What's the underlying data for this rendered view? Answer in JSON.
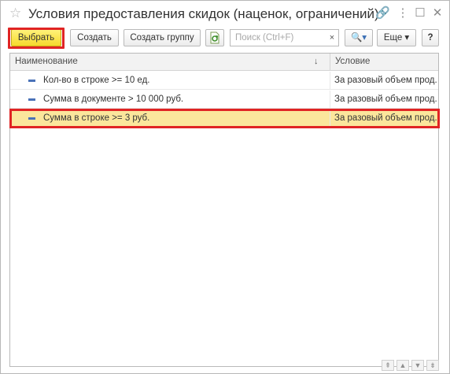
{
  "window": {
    "title": "Условия предоставления скидок (наценок, ограничений)"
  },
  "icons": {
    "star": "star-icon",
    "link": "link-icon",
    "more": "more-vertical-icon",
    "minimize": "minimize-icon",
    "maximize": "maximize-icon",
    "close": "close-icon"
  },
  "toolbar": {
    "select_label": "Выбрать",
    "create_label": "Создать",
    "create_group_label": "Создать группу",
    "search_placeholder": "Поиск (Ctrl+F)",
    "clear_label": "×",
    "search_label": "🔍▾",
    "more_label": "Еще ▾",
    "help_label": "?"
  },
  "table": {
    "columns": {
      "name": "Наименование",
      "condition": "Условие"
    },
    "sort_arrow": "↓",
    "rows": [
      {
        "name": "Кол-во в строке >= 10 ед.",
        "condition": "За разовый объем прод..."
      },
      {
        "name": "Сумма в документе > 10 000 руб.",
        "condition": "За разовый объем прод..."
      },
      {
        "name": "Сумма в строке >= 3 руб.",
        "condition": "За разовый объем прод..."
      }
    ]
  },
  "colors": {
    "primary_button": "#f6d92c",
    "selected_row": "#fbe69c",
    "highlight_border": "#e02424",
    "row_marker": "#4a72b8"
  }
}
